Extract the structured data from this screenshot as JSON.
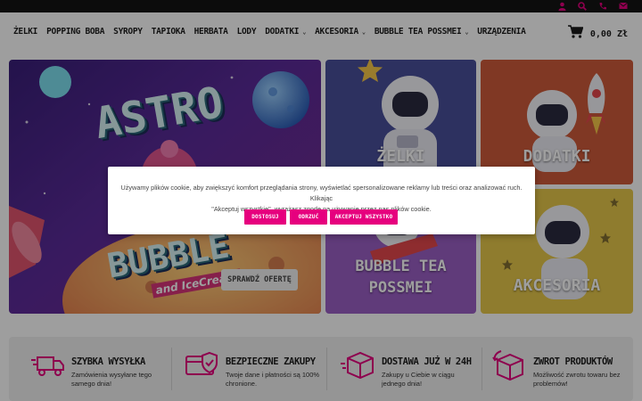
{
  "topbar": {
    "icons": [
      "user-icon",
      "search-icon",
      "phone-icon",
      "mail-icon"
    ],
    "accent": "#e6007e"
  },
  "nav": {
    "items": [
      {
        "label": "ŻELKI",
        "dropdown": false
      },
      {
        "label": "POPPING BOBA",
        "dropdown": false
      },
      {
        "label": "SYROPY",
        "dropdown": false
      },
      {
        "label": "TAPIOKA",
        "dropdown": false
      },
      {
        "label": "HERBATA",
        "dropdown": false
      },
      {
        "label": "LODY",
        "dropdown": false
      },
      {
        "label": "DODATKI",
        "dropdown": true
      },
      {
        "label": "AKCESORIA",
        "dropdown": true
      },
      {
        "label": "BUBBLE TEA POSSMEI",
        "dropdown": true
      },
      {
        "label": "URZĄDZENIA",
        "dropdown": false
      }
    ],
    "cart_total": "0,00 Zł"
  },
  "hero": {
    "title_line1": "ASTRO",
    "title_line2": "BUBBLE",
    "subtitle": "and IceCream",
    "button_label": "SPRAWDŹ OFERTĘ"
  },
  "tiles": {
    "zelki": "ŻELKI",
    "dodatki": "DODATKI",
    "bubble_line1": "BUBBLE TEA",
    "bubble_line2": "POSSMEI",
    "akcesoria": "AKCESORIA"
  },
  "features": [
    {
      "icon": "truck-icon",
      "title": "SZYBKA WYSYŁKA",
      "desc": "Zamówienia wysyłane tego samego dnia!"
    },
    {
      "icon": "shield-card-icon",
      "title": "BEZPIECZNE ZAKUPY",
      "desc": "Twoje dane i płatności są 100% chronione."
    },
    {
      "icon": "package-icon",
      "title": "DOSTAWA JUŻ W 24H",
      "desc": "Zakupy u Ciebie w ciągu jednego dnia!"
    },
    {
      "icon": "return-box-icon",
      "title": "ZWROT PRODUKTÓW",
      "desc": "Możliwość zwrotu towaru bez problemów!"
    }
  ],
  "cookie": {
    "text_line1": "Używamy plików cookie, aby zwiększyć komfort przeglądania strony, wyświetlać spersonalizowane reklamy lub treści oraz analizować ruch. Klikając",
    "text_line2": "\"Akceptuj wszystkie\", wyrażasz zgodę na używanie przez nas plików cookie.",
    "btn_customize": "DOSTOSUJ",
    "btn_reject": "ODRZUĆ",
    "btn_accept": "AKCEPTUJ WSZYSTKO",
    "accent": "#e6007e"
  }
}
